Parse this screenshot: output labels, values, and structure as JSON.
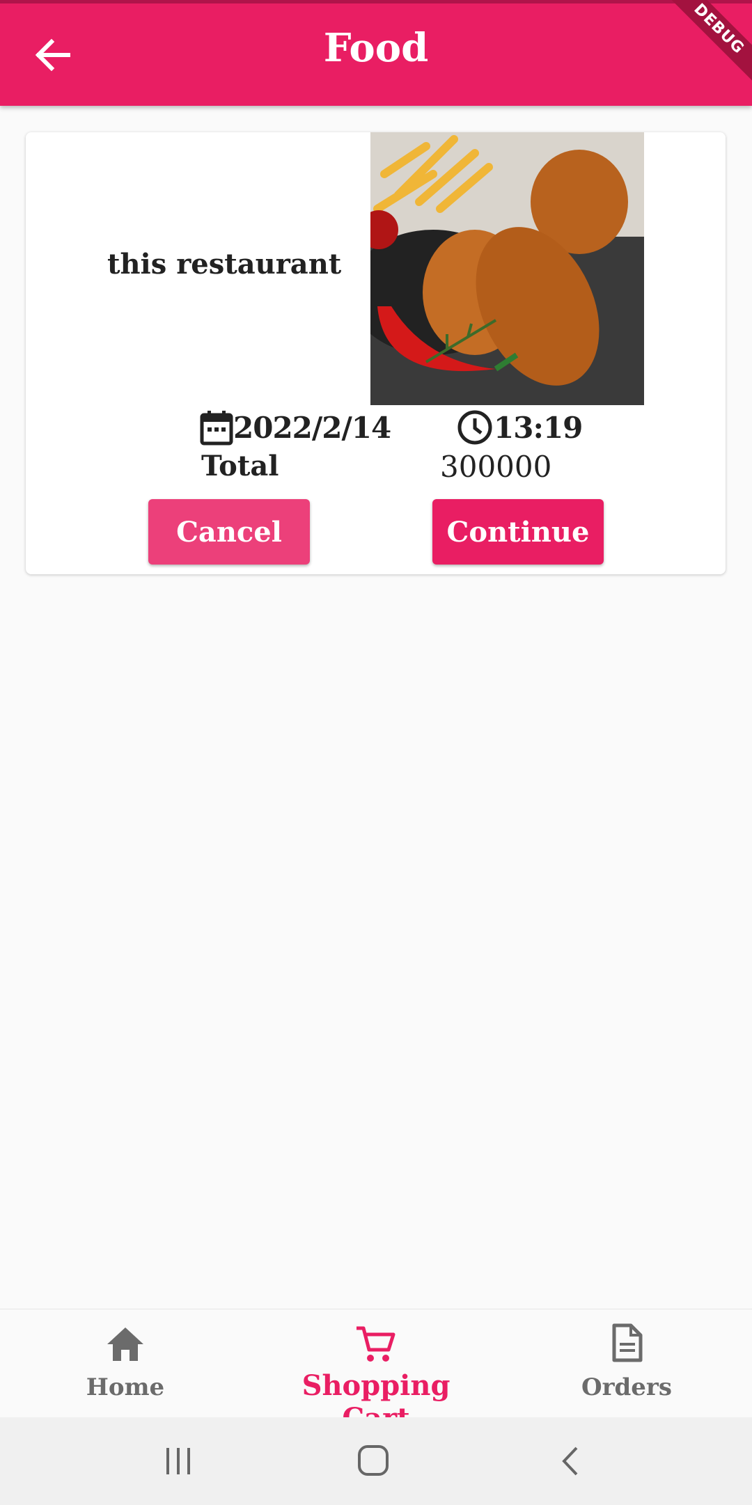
{
  "appbar": {
    "title": "Food",
    "back_icon": "arrow-left-icon",
    "debug_banner": "DEBUG",
    "color": "#e91e63"
  },
  "order": {
    "restaurant": "this restaurant",
    "image_alt": "fried-chicken-photo",
    "date_icon": "calendar-icon",
    "date": "2022/2/14",
    "time_icon": "clock-icon",
    "time": "13:19",
    "total_label": "Total",
    "total_value": "300000",
    "cancel_label": "Cancel",
    "continue_label": "Continue"
  },
  "bottom_nav": {
    "items": [
      {
        "label": "Home",
        "icon": "home-icon",
        "active": false
      },
      {
        "label": "Shopping Cart",
        "icon": "cart-icon",
        "active": true
      },
      {
        "label": "Orders",
        "icon": "document-icon",
        "active": false
      }
    ],
    "active_color": "#e91e63",
    "inactive_color": "#6b6b6b"
  },
  "system_nav": {
    "icons": [
      "recent-apps-icon",
      "home-circle-icon",
      "back-chevron-icon"
    ]
  }
}
